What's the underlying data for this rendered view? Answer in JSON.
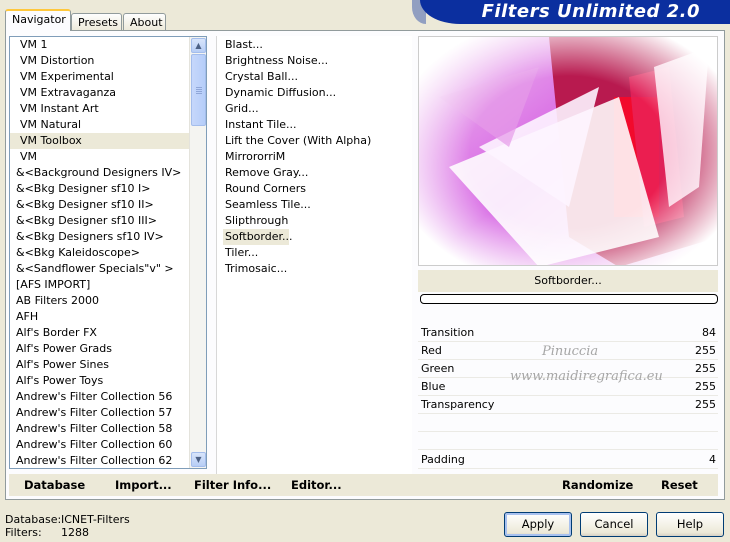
{
  "tabs": [
    {
      "label": "Navigator",
      "active": true
    },
    {
      "label": "Presets",
      "active": false
    },
    {
      "label": "About",
      "active": false
    }
  ],
  "title": "Filters Unlimited 2.0",
  "categories": [
    "VM 1",
    "VM Distortion",
    "VM Experimental",
    "VM Extravaganza",
    "VM Instant Art",
    "VM Natural",
    "VM Toolbox",
    "VM",
    "&<Background Designers IV>",
    "&<Bkg Designer sf10 I>",
    "&<Bkg Designer sf10 II>",
    "&<Bkg Designer sf10 III>",
    "&<Bkg Designers sf10 IV>",
    "&<Bkg Kaleidoscope>",
    "&<Sandflower Specials\"v\" >",
    "[AFS IMPORT]",
    "AB Filters 2000",
    "AFH",
    "Alf's Border FX",
    "Alf's Power Grads",
    "Alf's Power Sines",
    "Alf's Power Toys",
    "Andrew's Filter Collection 56",
    "Andrew's Filter Collection 57",
    "Andrew's Filter Collection 58",
    "Andrew's Filter Collection 60",
    "Andrew's Filter Collection 62"
  ],
  "selected_category": "VM Toolbox",
  "filters": [
    "Blast...",
    "Brightness Noise...",
    "Crystal Ball...",
    "Dynamic Diffusion...",
    "Grid...",
    "Instant Tile...",
    "Lift the Cover (With Alpha)",
    "MirrororriM",
    "Remove Gray...",
    "Round Corners",
    "Seamless Tile...",
    "Slipthrough",
    "Softborder...",
    "Tiler...",
    "Trimosaic..."
  ],
  "selected_filter": "Softborder...",
  "filter_name": "Softborder...",
  "parameters": [
    {
      "label": "Transition",
      "value": "84"
    },
    {
      "label": "Red",
      "value": "255"
    },
    {
      "label": "Green",
      "value": "255"
    },
    {
      "label": "Blue",
      "value": "255"
    },
    {
      "label": "Transparency",
      "value": "255"
    }
  ],
  "padding": {
    "label": "Padding",
    "value": "4"
  },
  "watermark": {
    "line1": "Pinuccia",
    "line2": "www.maidiregrafica.eu"
  },
  "actions": {
    "database": "Database",
    "import": "Import...",
    "filter_info": "Filter Info...",
    "editor": "Editor...",
    "randomize": "Randomize",
    "reset": "Reset"
  },
  "status": {
    "database_label": "Database:",
    "database_value": "ICNET-Filters",
    "filters_label": "Filters:",
    "filters_value": "1288"
  },
  "buttons": {
    "apply": "Apply",
    "cancel": "Cancel",
    "help": "Help"
  },
  "colors": {
    "banner": "#0b2f9f",
    "accent_tab": "#ffc83c",
    "panel": "#ece9d8"
  }
}
